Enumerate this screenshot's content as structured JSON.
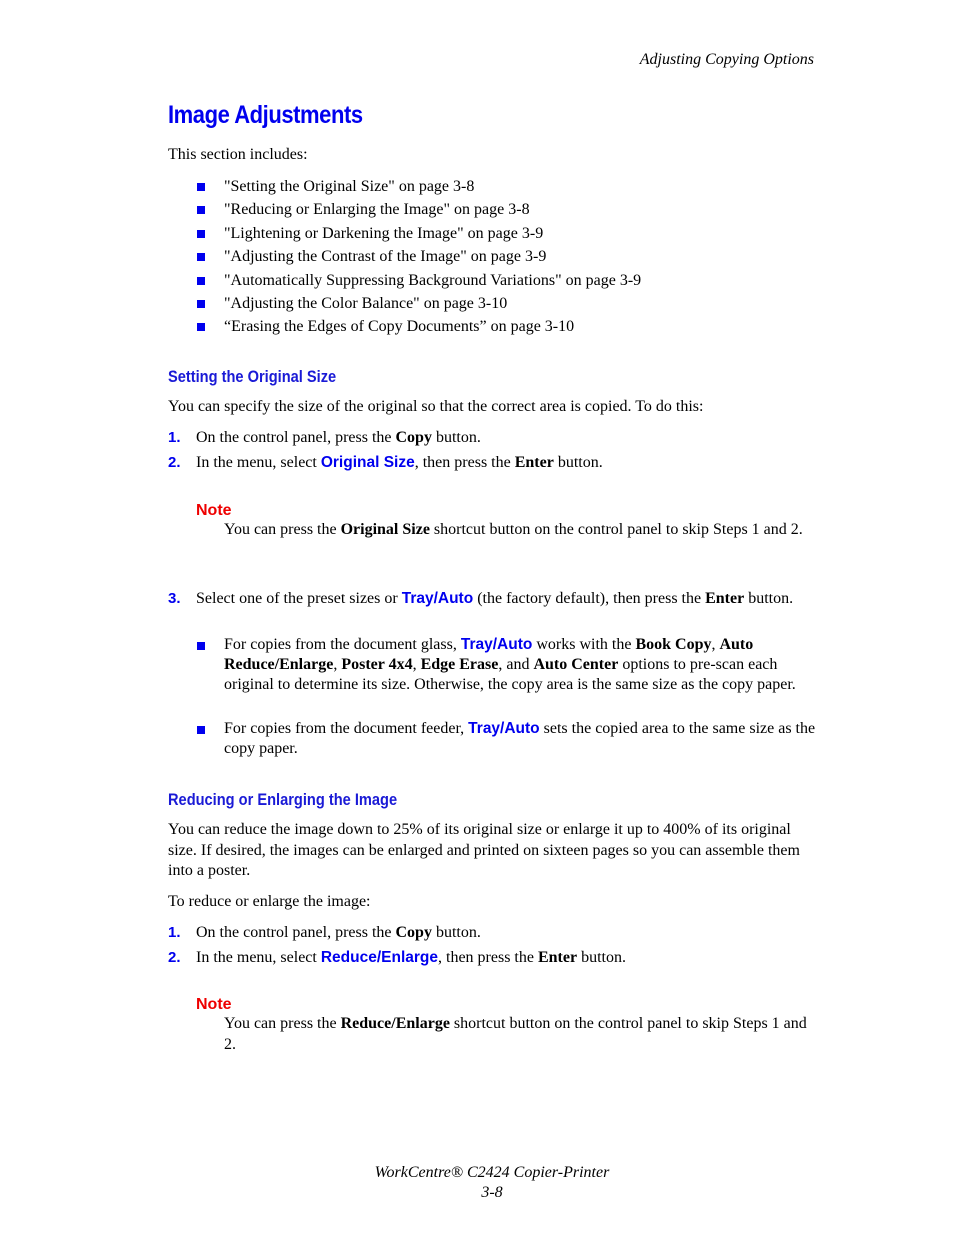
{
  "running_head": "Adjusting Copying Options",
  "title": "Image Adjustments",
  "intro": "This section includes:",
  "toc": [
    "\"Setting the Original Size\" on page 3-8",
    "\"Reducing or Enlarging the Image\" on page 3-8",
    "\"Lightening or Darkening the Image\" on page 3-9",
    "\"Adjusting the Contrast of the Image\" on page 3-9",
    "\"Automatically Suppressing Background Variations\" on page 3-9",
    "\"Adjusting the Color Balance\" on page 3-10",
    "“Erasing the Edges of Copy Documents” on page 3-10"
  ],
  "section1": {
    "heading": "Setting the Original Size",
    "intro": "You can specify the size of the original so that the correct area is copied. To do this:",
    "step1": {
      "num": "1.",
      "a": "On the control panel, press the ",
      "b": "Copy",
      "c": " button."
    },
    "step2": {
      "num": "2.",
      "a": "In the menu, select ",
      "ui": "Original Size",
      "c": ", then press the ",
      "b": "Enter",
      "d": " button."
    },
    "note": {
      "label": "Note",
      "a": "You can press the ",
      "b": "Original Size",
      "c": " shortcut button on the control panel to skip Steps 1 and 2."
    },
    "step3": {
      "num": "3.",
      "a": "Select one of the preset sizes or ",
      "ui": "Tray/Auto",
      "c": " (the factory default), then press the ",
      "b": "Enter",
      "d": " button."
    },
    "sub1": {
      "a": "For copies from the document glass, ",
      "ui": "Tray/Auto",
      "b": " works with the ",
      "t1": "Book Copy",
      "s1": ", ",
      "t2": "Auto Reduce/Enlarge",
      "s2": ", ",
      "t3": "Poster 4x4",
      "s3": ", ",
      "t4": "Edge Erase",
      "s4": ", and ",
      "t5": "Auto Center",
      "c": " options to pre-scan each original to determine its size. Otherwise, the copy area is the same size as the copy paper."
    },
    "sub2": {
      "a": "For copies from the document feeder, ",
      "ui": "Tray/Auto",
      "b": " sets the copied area to the same size as the copy paper."
    }
  },
  "section2": {
    "heading": "Reducing or Enlarging the Image",
    "intro": "You can reduce the image down to 25% of its original size or enlarge it up to 400% of its original size. If desired, the images can be enlarged and printed on sixteen pages so you can assemble them into a poster.",
    "lead": "To reduce or enlarge the image:",
    "step1": {
      "num": "1.",
      "a": "On the control panel, press the ",
      "b": "Copy",
      "c": " button."
    },
    "step2": {
      "num": "2.",
      "a": "In the menu, select ",
      "ui": "Reduce/Enlarge",
      "c": ", then press the ",
      "b": "Enter",
      "d": " button."
    },
    "note": {
      "label": "Note",
      "a": "You can press the ",
      "b": "Reduce/Enlarge",
      "c": " shortcut button on the control panel to skip Steps 1 and 2."
    }
  },
  "footer": {
    "product": "WorkCentre® C2424 Copier-Printer",
    "page": "3-8"
  }
}
